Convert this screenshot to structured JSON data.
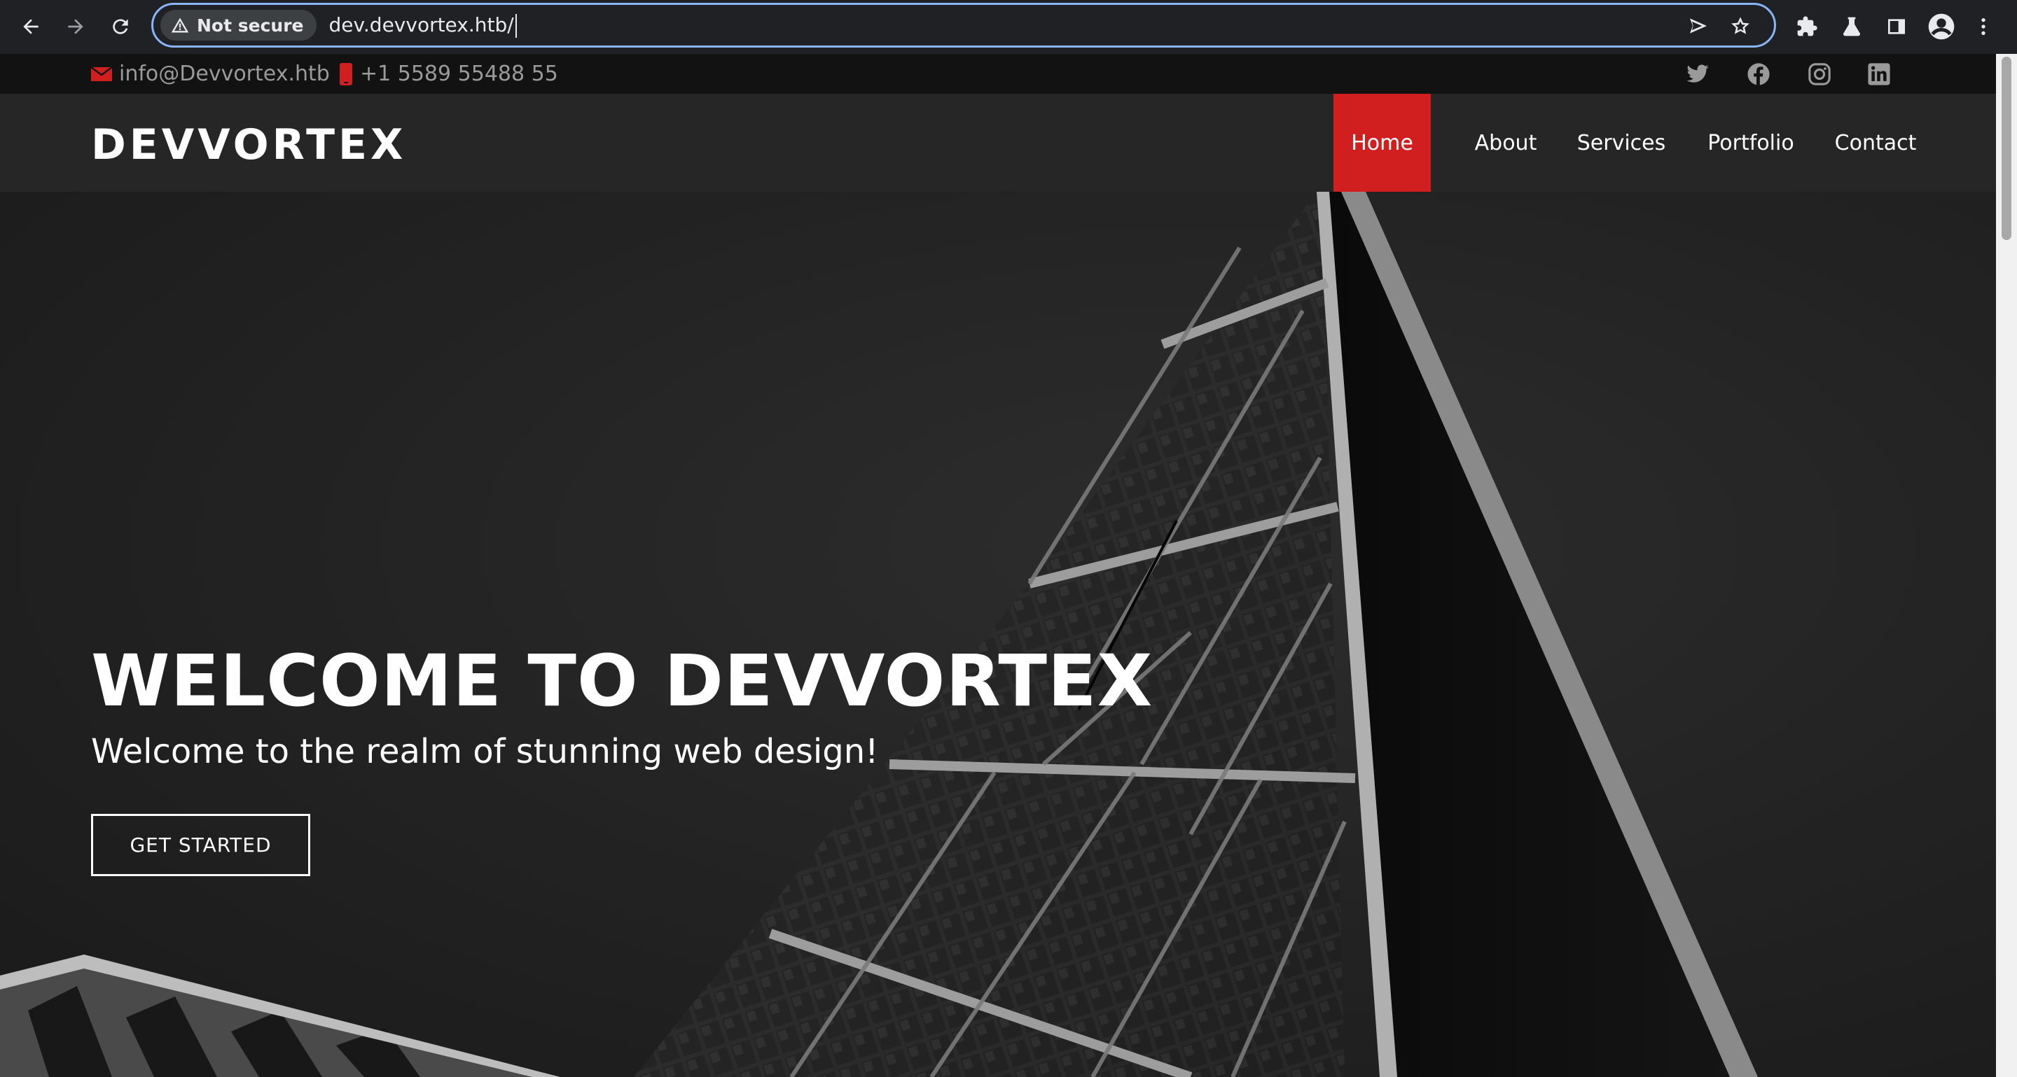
{
  "browser": {
    "security_label": "Not secure",
    "url": "dev.devvortex.htb/",
    "accent": "#8ab4f8"
  },
  "topbar": {
    "email": "info@Devvortex.htb",
    "phone": "+1 5589 55488 55",
    "icons": [
      "envelope-icon",
      "phone-icon",
      "twitter-icon",
      "facebook-icon",
      "instagram-icon",
      "linkedin-icon"
    ]
  },
  "header": {
    "logo": "DEVVORTEX",
    "nav": [
      {
        "label": "Home",
        "active": true
      },
      {
        "label": "About"
      },
      {
        "label": "Services"
      },
      {
        "label": "Portfolio"
      },
      {
        "label": "Contact"
      }
    ],
    "accent_color": "#d11f1f"
  },
  "hero": {
    "title": "WELCOME TO DEVVORTEX",
    "subtitle": "Welcome to the realm of stunning web design!",
    "cta_label": "GET STARTED"
  }
}
